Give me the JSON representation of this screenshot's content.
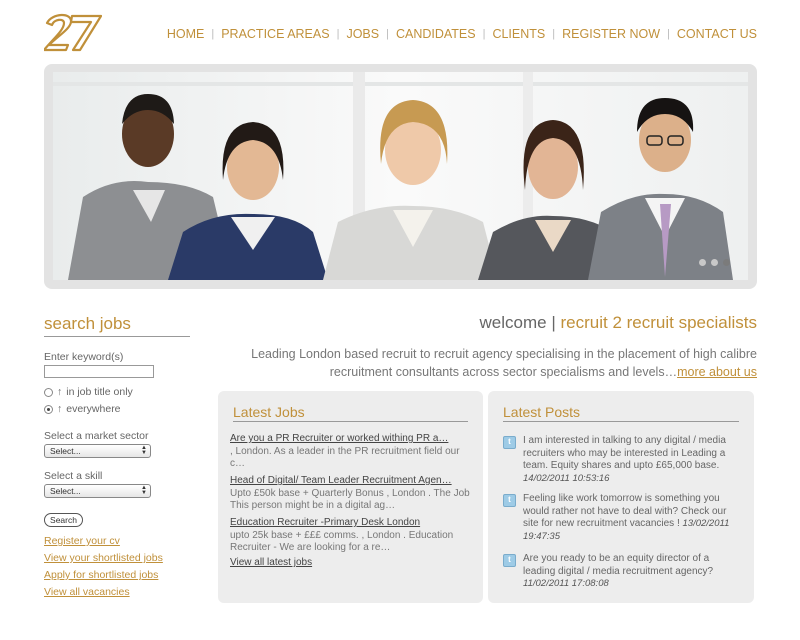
{
  "logo": {
    "text": "2/7"
  },
  "nav": {
    "items": [
      "HOME",
      "PRACTICE AREAS",
      "JOBS",
      "CANDIDATES",
      "CLIENTS",
      "REGISTER NOW",
      "CONTACT US"
    ]
  },
  "hero": {
    "slides_total": 3,
    "active_slide": 3
  },
  "sidebar": {
    "title": "search jobs",
    "keyword_label": "Enter keyword(s)",
    "keyword_value": "",
    "radio_title_only": "in job title only",
    "radio_everywhere": "everywhere",
    "sector_label": "Select a market sector",
    "sector_value": "Select...",
    "skill_label": "Select a skill",
    "skill_value": "Select...",
    "search_button": "Search",
    "links": [
      "Register your cv",
      "View your shortlisted jobs",
      "Apply for shortlisted jobs",
      "View all vacancies"
    ]
  },
  "welcome": {
    "prefix": "welcome | ",
    "accent": "recruit 2 recruit specialists"
  },
  "intro": {
    "text": "Leading London based recruit to recruit agency specialising in the placement of high calibre recruitment consultants across sector specialisms and levels…",
    "more_link": "more about us"
  },
  "jobs": {
    "title": "Latest Jobs",
    "items": [
      {
        "title": "Are you a PR Recruiter or worked withing PR a…",
        "desc": ", London. As a leader in the PR recruitment field our c…"
      },
      {
        "title": "Head of Digital/ Team Leader Recruitment Agen…",
        "desc": "Upto £50k base + Quarterly Bonus , London . The Job This person might be in a digital ag…"
      },
      {
        "title": "Education Recruiter -Primary Desk London",
        "desc": "upto 25k base + £££ comms. , London . Education Recruiter - We are looking for a re…"
      }
    ],
    "view_all": "View all latest jobs"
  },
  "posts": {
    "title": "Latest Posts",
    "items": [
      {
        "text": "I am interested in talking to any digital / media recruiters who may be interested in Leading a team. Equity shares and upto £65,000 base.",
        "date": "14/02/2011 10:53:16"
      },
      {
        "text": "Feeling like work tomorrow is something you would rather not have to deal with? Check our site for new recruitment vacancies !",
        "date": "13/02/2011 19:47:35"
      },
      {
        "text": "Are you ready to be an equity director of a leading digital / media recruitment agency?",
        "date": "11/02/2011 17:08:08"
      }
    ]
  },
  "colors": {
    "accent": "#c0903a",
    "panel": "#ededed",
    "text": "#666666"
  }
}
